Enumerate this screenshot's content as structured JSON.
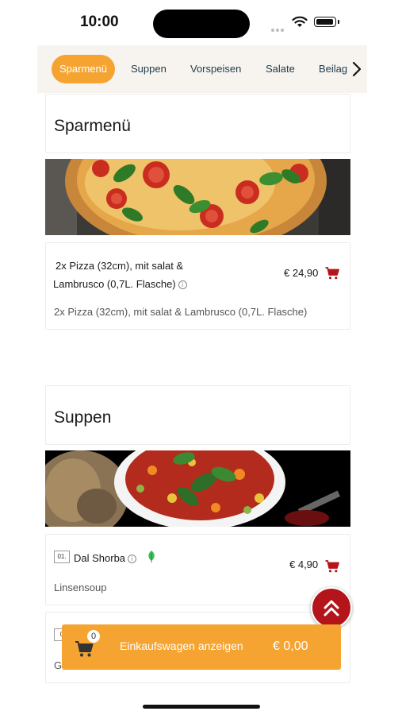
{
  "status_bar": {
    "time": "10:00"
  },
  "categories": {
    "items": [
      "Sparmenü",
      "Suppen",
      "Vorspeisen",
      "Salate",
      "Beilag"
    ],
    "active_index": 0
  },
  "sections": [
    {
      "title": "Sparmenü",
      "items": [
        {
          "name_line1": "2x Pizza (32cm), mit salat &",
          "name_line2": "Lambrusco (0,7L. Flasche)",
          "price": "€ 24,90",
          "description": "2x Pizza (32cm), mit salat & Lambrusco (0,7L. Flasche)"
        }
      ]
    },
    {
      "title": "Suppen",
      "items": [
        {
          "number": "01.",
          "name": "Dal Shorba",
          "price": "€ 4,90",
          "description": "Linsensoup",
          "vegetarian": true
        },
        {
          "number": "0",
          "description": "G"
        }
      ]
    }
  ],
  "cart": {
    "count": "0",
    "label": "Einkaufswagen anzeigen",
    "total": "€ 0,00"
  },
  "colors": {
    "accent": "#f5a431",
    "cart_icon": "#b3151b",
    "scroll_top": "#b3151b",
    "leaf": "#3bbf5b"
  }
}
